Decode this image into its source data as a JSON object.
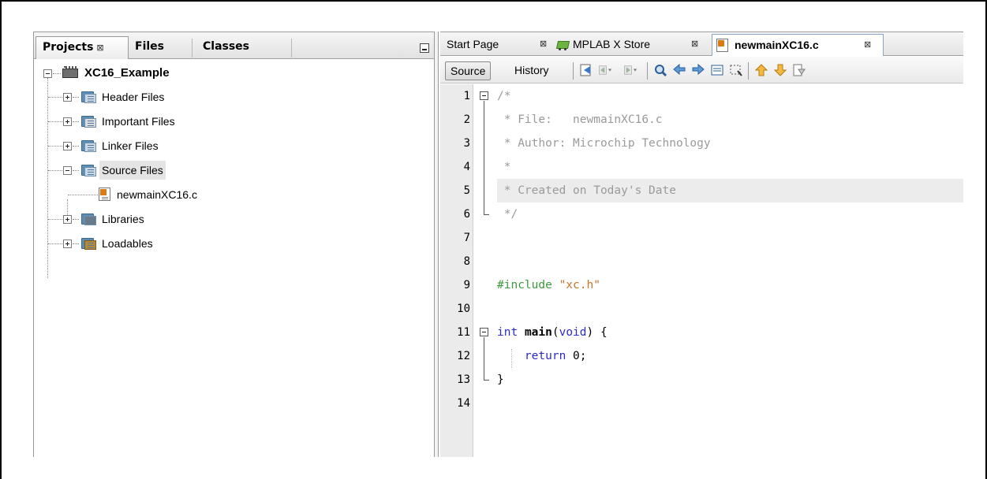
{
  "left_panel": {
    "tabs": [
      "Projects",
      "Files",
      "Classes"
    ],
    "close_glyph": "⊠",
    "tree": {
      "project": "XC16_Example",
      "items": [
        "Header Files",
        "Important Files",
        "Linker Files",
        "Source Files",
        "newmainXC16.c",
        "Libraries",
        "Loadables"
      ]
    }
  },
  "editor": {
    "tabs": [
      "Start Page",
      "MPLAB X Store",
      "newmainXC16.c"
    ],
    "close_glyph": "⊠",
    "toolbar": {
      "source": "Source",
      "history": "History"
    },
    "line_numbers": [
      "1",
      "2",
      "3",
      "4",
      "5",
      "6",
      "7",
      "8",
      "9",
      "10",
      "11",
      "12",
      "13",
      "14"
    ],
    "code": {
      "l1": "/*",
      "l2": " * File:   newmainXC16.c",
      "l3": " * Author: Microchip Technology",
      "l4": " *",
      "l5": " * Created on Today's Date",
      "l6": " */",
      "l9_directive": "#include",
      "l9_string": "\"xc.h\"",
      "l11_type": "int",
      "l11_name": "main",
      "l11_open": "(",
      "l11_void": "void",
      "l11_close": ") {",
      "l12_kw": "return",
      "l12_rest": " 0;",
      "l13": "}"
    }
  }
}
